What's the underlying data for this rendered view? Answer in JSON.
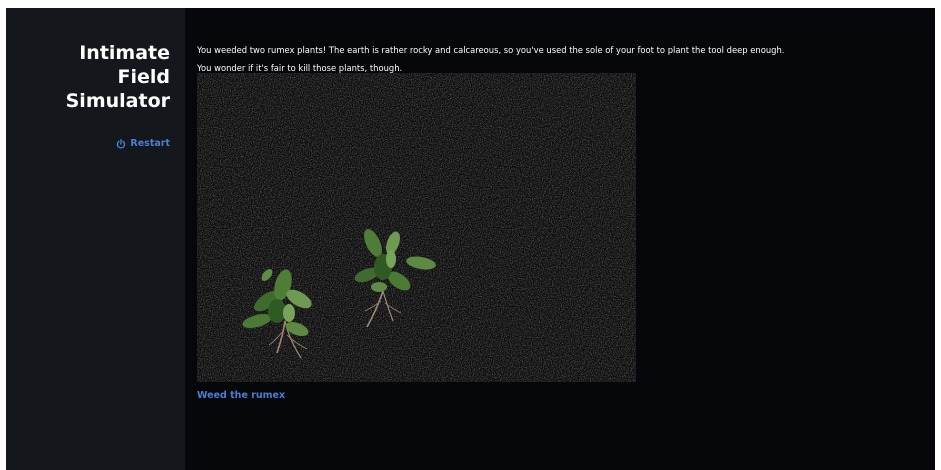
{
  "sidebar": {
    "title_lines": [
      "Intimate",
      "Field",
      "Simulator"
    ],
    "restart_icon": "power-icon",
    "restart_label": "Restart",
    "link_color": "#4a7fd4"
  },
  "passage": {
    "text_lines": [
      "You weeded two rumex plants! The earth is rather rocky and calcareous, so you've used the sole of your foot to plant the tool deep enough.",
      "You wonder if it's fair to kill those plants, though."
    ],
    "image": {
      "subject": "two uprooted rumex plants on dark soil",
      "plant_count": 2
    },
    "action_label": "Weed the rumex"
  },
  "colors": {
    "page_background": "#05070a",
    "sidebar_background": "#14181c",
    "text": "#ffffff",
    "link": "#4a7fd4"
  }
}
